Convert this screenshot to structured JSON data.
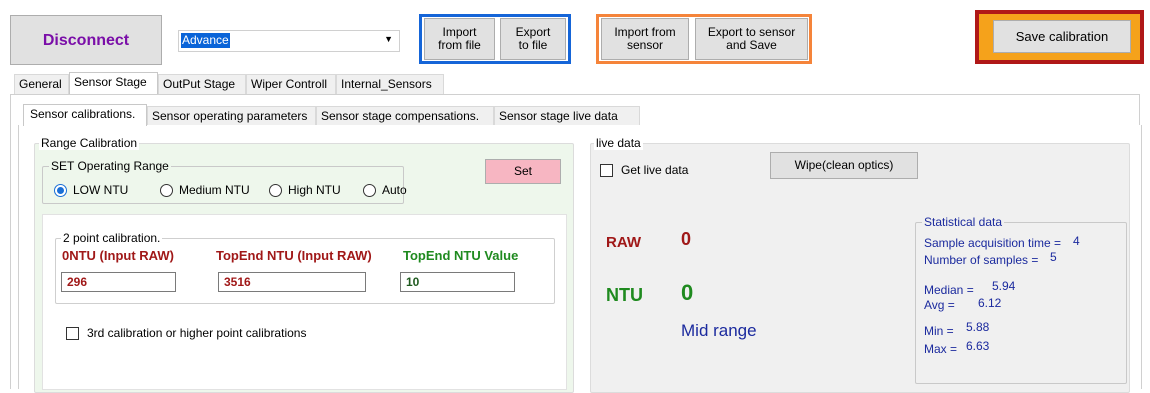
{
  "toolbar": {
    "disconnect_label": "Disconnect",
    "mode_select_value": "Advance",
    "import_file_label": "Import\nfrom file",
    "export_file_label": "Export\nto file",
    "import_sensor_label": "Import from\nsensor",
    "export_sensor_label": "Export to sensor\nand Save",
    "save_calibration_label": "Save calibration"
  },
  "main_tabs": [
    "General",
    "Sensor Stage",
    "OutPut Stage",
    "Wiper Controll",
    "Internal_Sensors"
  ],
  "sub_tabs": [
    "Sensor calibrations.",
    "Sensor operating parameters",
    "Sensor stage compensations.",
    "Sensor stage live data"
  ],
  "range_calibration": {
    "title": "Range Calibration",
    "set_operating_range": {
      "title": "SET Operating Range",
      "options": [
        "LOW NTU",
        "Medium NTU",
        "High NTU",
        "Auto"
      ],
      "selected": "LOW NTU"
    },
    "set_button_label": "Set",
    "two_point": {
      "title": "2 point calibration.",
      "zero_label": "0NTU (Input RAW)",
      "zero_value": "296",
      "topend_raw_label": "TopEnd NTU (Input RAW)",
      "topend_raw_value": "3516",
      "topend_value_label": "TopEnd NTU Value",
      "topend_value": "10"
    },
    "third_calibration_label": "3rd calibration or higher point calibrations"
  },
  "live_data": {
    "title": "live data",
    "get_live_label": "Get live data",
    "wipe_button_label": "Wipe(clean optics)",
    "raw_label": "RAW",
    "raw_value": "0",
    "ntu_label": "NTU",
    "ntu_value": "0",
    "range_text": "Mid range",
    "stats": {
      "title": "Statistical data",
      "sample_time_label": "Sample acquisition time =",
      "sample_time_value": "4",
      "num_samples_label": "Number of samples =",
      "num_samples_value": "5",
      "median_label": "Median =",
      "median_value": "5.94",
      "avg_label": "Avg =",
      "avg_value": "6.12",
      "min_label": "Min =",
      "min_value": "5.88",
      "max_label": "Max =",
      "max_value": "6.63"
    }
  },
  "colors": {
    "disconnect_text": "#7a0ea8",
    "blue_frame": "#1565d8",
    "orange_frame": "#f5843a",
    "red_frame": "#b01818",
    "save_fill": "#f5a21b",
    "set_button": "#f7b6c2",
    "dark_red_text": "#a01818",
    "green_text": "#1f8a1f",
    "stats_blue": "#1b2a9e",
    "calib_green_bg": "#eef7ec"
  }
}
